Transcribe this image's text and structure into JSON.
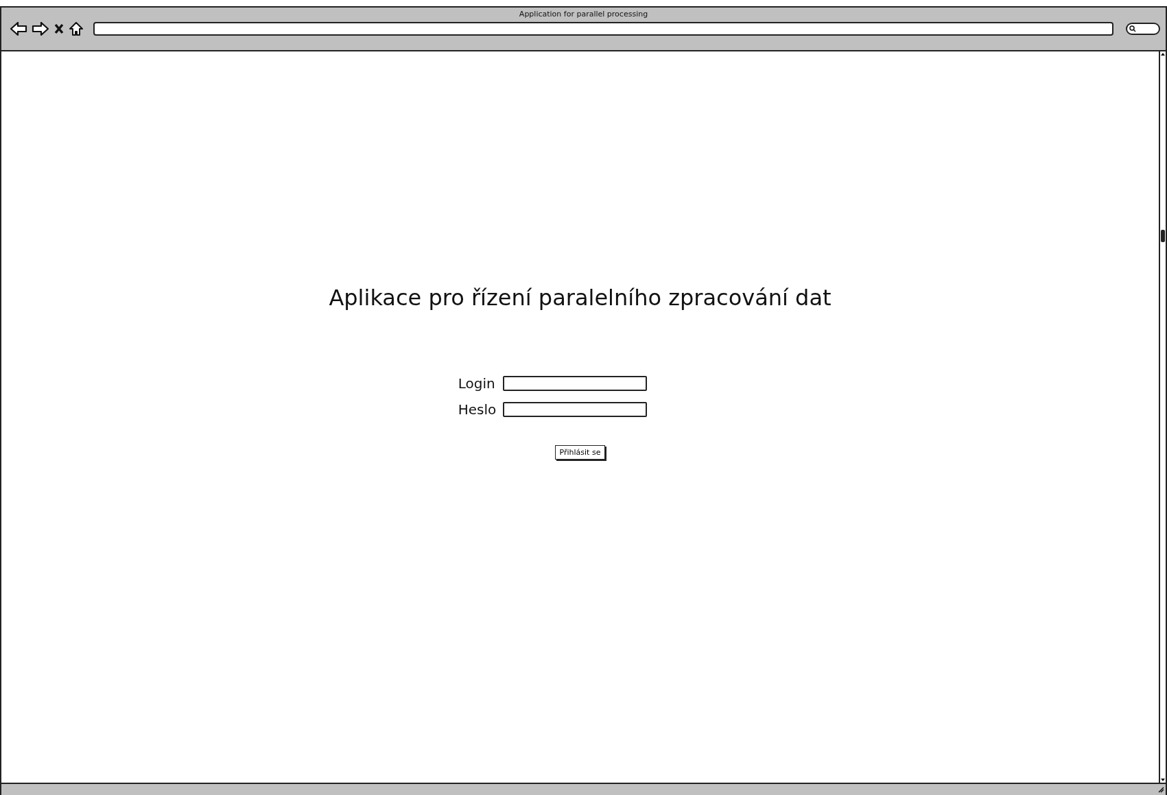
{
  "window": {
    "title": "Application for parallel processing"
  },
  "page": {
    "heading": "Aplikace pro řízení paralelního zpracování dat",
    "fields": [
      {
        "label": "Login"
      },
      {
        "label": "Heslo"
      }
    ],
    "button": "Přihlásit se"
  }
}
